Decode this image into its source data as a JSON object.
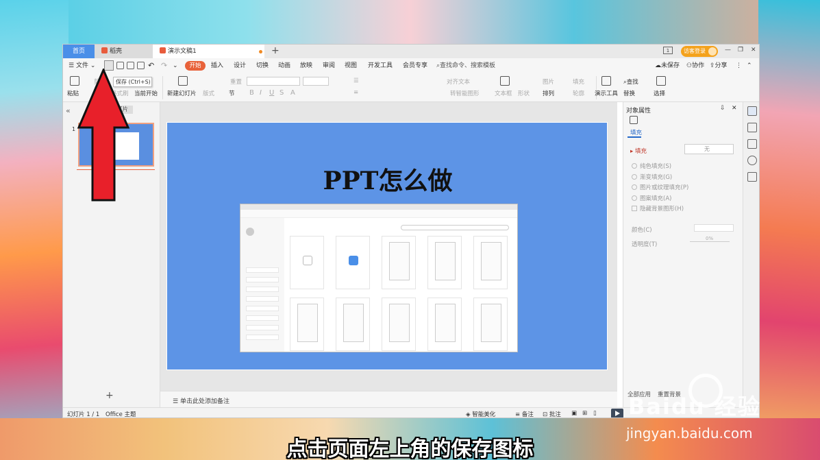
{
  "tabs": {
    "home": "首页",
    "daoke": "稻壳",
    "document": "演示文稿1",
    "login": "访客登录"
  },
  "menu": {
    "file": "文件",
    "start": "开始",
    "insert": "插入",
    "design": "设计",
    "transition": "切换",
    "animation": "动画",
    "slideshow": "放映",
    "review": "审阅",
    "view": "视图",
    "devtools": "开发工具",
    "member": "会员专享",
    "search": "查找命令、搜索模板",
    "unsaved": "未保存",
    "collab": "协作",
    "share": "分享"
  },
  "tooltip": "保存 (Ctrl+S)",
  "ribbon": {
    "paste": "粘贴",
    "cut": "剪切",
    "format_painter": "格式刷",
    "from_current": "当前开始",
    "new_slide": "新建幻灯片",
    "layout": "版式",
    "section": "节",
    "reset": "重置",
    "align_text": "对齐文本",
    "smart_shape": "转智能图形",
    "textbox": "文本框",
    "shape": "形状",
    "picture": "图片",
    "arrange": "排列",
    "fill": "填充",
    "outline": "轮廓",
    "present_tools": "演示工具",
    "find": "查找",
    "replace": "替换",
    "select": "选择"
  },
  "left_panel": {
    "tab_outline": "大",
    "tab_slides": "灯片",
    "slide_number": "1"
  },
  "slide": {
    "title": "PPT怎么做"
  },
  "notes": "单击此处添加备注",
  "right_panel": {
    "title": "对象属性",
    "subtab": "填充",
    "section_fill": "填充",
    "fill_value": "无",
    "options": [
      "纯色填充(S)",
      "渐变填充(G)",
      "图片或纹理填充(P)",
      "图案填充(A)"
    ],
    "hide_bg": "隐藏背景图形(H)",
    "color": "颜色(C)",
    "transparency": "透明度(T)",
    "transparency_value": "0%",
    "apply_all": "全部应用",
    "reset_bg": "重置背景"
  },
  "status": {
    "slide_count": "幻灯片 1 / 1",
    "theme": "Office 主题",
    "beautify": "智能美化",
    "notes": "备注",
    "comments": "批注"
  },
  "caption": "点击页面左上角的保存图标",
  "watermark": {
    "brand": "Baidu 经验",
    "url": "jingyan.baidu.com"
  },
  "colors": {
    "accent_orange": "#e8623a",
    "slide_bg": "#5d94e6",
    "tab_home": "#4a8fe8",
    "arrow": "#e8202a"
  }
}
